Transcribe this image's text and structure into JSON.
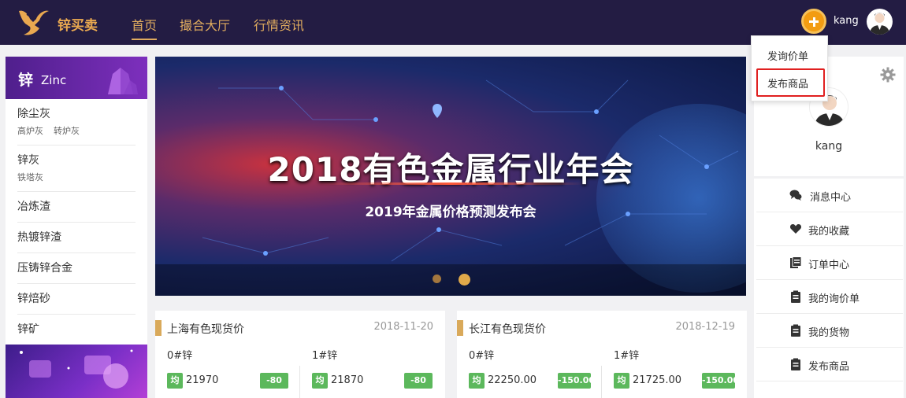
{
  "header": {
    "brand": "锌买卖",
    "nav": [
      {
        "label": "首页",
        "active": true
      },
      {
        "label": "撮合大厅",
        "active": false
      },
      {
        "label": "行情资讯",
        "active": false
      }
    ],
    "username": "kang",
    "plus_icon": "plus-circle-icon"
  },
  "dropdown": {
    "items": [
      "发询价单",
      "发布商品"
    ],
    "highlighted": "发布商品"
  },
  "sidebar": {
    "header_cn": "锌",
    "header_en": "Zinc",
    "categories": [
      {
        "title": "除尘灰",
        "subs": [
          "高炉灰",
          "转炉灰"
        ]
      },
      {
        "title": "锌灰",
        "subs": [
          "铁塔灰"
        ]
      },
      {
        "title": "冶炼渣",
        "subs": []
      },
      {
        "title": "热镀锌渣",
        "subs": []
      },
      {
        "title": "压铸锌合金",
        "subs": []
      },
      {
        "title": "锌焙砂",
        "subs": []
      },
      {
        "title": "锌矿",
        "subs": []
      }
    ]
  },
  "banner": {
    "title": "2018有色金属行业年会",
    "subtitle": "2019年金属价格预测发布会",
    "slides": 2,
    "active_slide": 2
  },
  "price_cards": [
    {
      "title": "上海有色现货价",
      "date": "2018-11-20",
      "columns": [
        {
          "label": "0#锌",
          "avg_label": "均",
          "price": "21970",
          "change": "-80"
        },
        {
          "label": "1#锌",
          "avg_label": "均",
          "price": "21870",
          "change": "-80"
        }
      ]
    },
    {
      "title": "长江有色现货价",
      "date": "2018-12-19",
      "columns": [
        {
          "label": "0#锌",
          "avg_label": "均",
          "price": "22250.00",
          "change": "-150.00"
        },
        {
          "label": "1#锌",
          "avg_label": "均",
          "price": "21725.00",
          "change": "-150.00"
        }
      ]
    }
  ],
  "profile": {
    "name": "kang",
    "settings_icon": "gear-icon"
  },
  "user_menu": [
    {
      "label": "消息中心",
      "icon": "chat-icon"
    },
    {
      "label": "我的收藏",
      "icon": "heart-icon"
    },
    {
      "label": "订单中心",
      "icon": "orders-icon"
    },
    {
      "label": "我的询价单",
      "icon": "clipboard-icon"
    },
    {
      "label": "我的货物",
      "icon": "clipboard-icon"
    },
    {
      "label": "发布商品",
      "icon": "clipboard-icon"
    }
  ],
  "colors": {
    "header_bg": "#231c43",
    "accent_gold": "#e0ac5f",
    "green_badge": "#5cb85c",
    "highlight_red": "#e02020"
  }
}
